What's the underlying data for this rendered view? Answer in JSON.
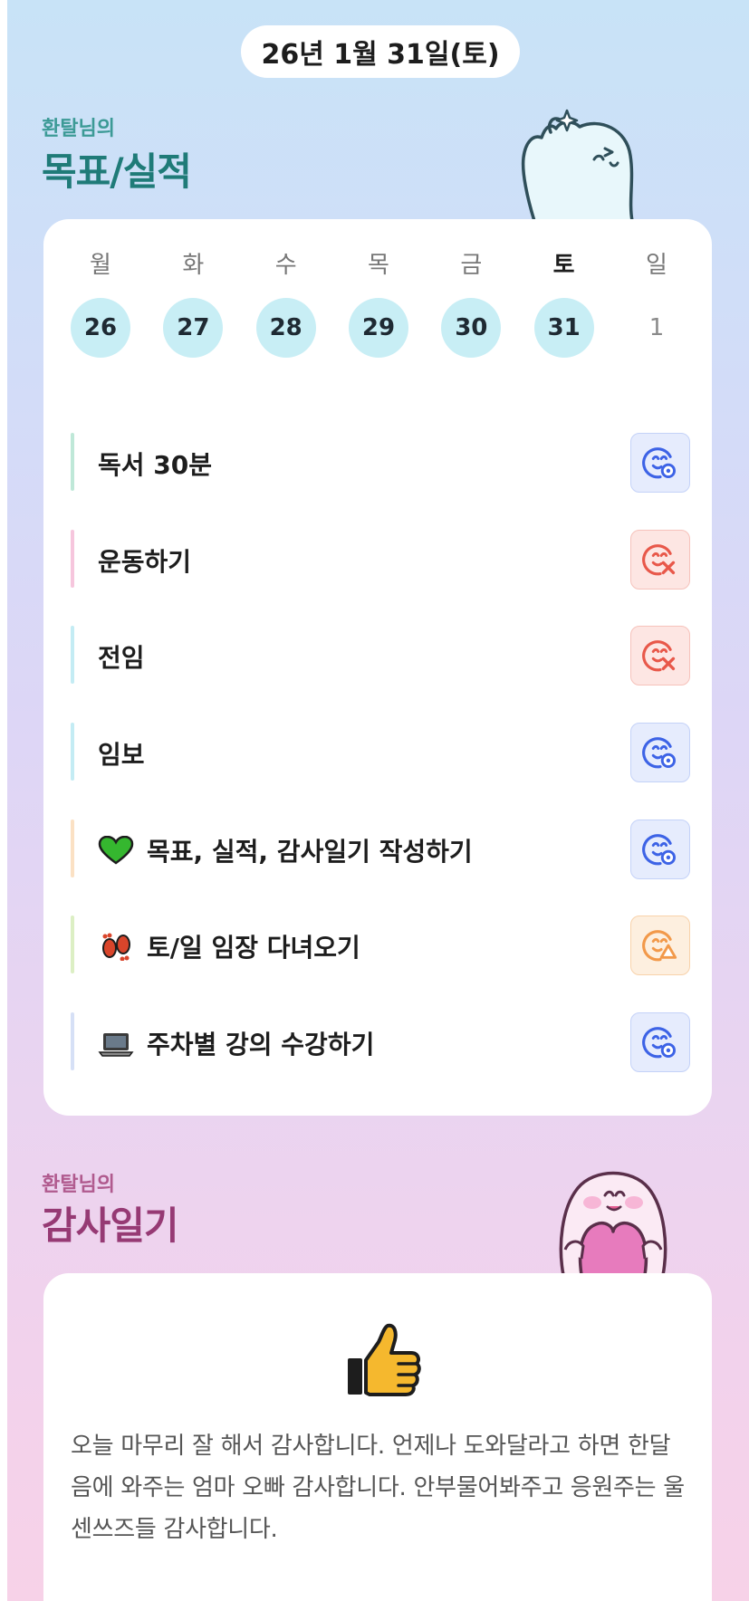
{
  "header": {
    "date": "26년 1월 31일(토)"
  },
  "goals": {
    "owner": "환탈님의",
    "title": "목표/실적",
    "week": {
      "days": [
        "월",
        "화",
        "수",
        "목",
        "금",
        "토",
        "일"
      ],
      "dates": [
        "26",
        "27",
        "28",
        "29",
        "30",
        "31",
        "1"
      ],
      "marked": [
        true,
        true,
        true,
        true,
        true,
        true,
        false
      ],
      "today_index": 5
    },
    "tasks": [
      {
        "label": "독서 30분",
        "emoji": "",
        "bar_color": "#bfe8d8",
        "status": "good",
        "status_icon": "smile-check-icon"
      },
      {
        "label": "운동하기",
        "emoji": "",
        "bar_color": "#f6c6dd",
        "status": "bad",
        "status_icon": "smile-x-icon"
      },
      {
        "label": "전임",
        "emoji": "",
        "bar_color": "#c4ecf4",
        "status": "bad",
        "status_icon": "smile-x-icon"
      },
      {
        "label": "임보",
        "emoji": "",
        "bar_color": "#c4ecf4",
        "status": "good",
        "status_icon": "smile-check-icon"
      },
      {
        "label": "목표, 실적, 감사일기 작성하기",
        "emoji": "green-heart",
        "bar_color": "#fbe1c4",
        "status": "good",
        "status_icon": "smile-check-icon"
      },
      {
        "label": "토/일 임장 다녀오기",
        "emoji": "footprints",
        "bar_color": "#dcefc4",
        "status": "warn",
        "status_icon": "smile-warning-icon"
      },
      {
        "label": "주차별 강의 수강하기",
        "emoji": "laptop",
        "bar_color": "#d6e0f6",
        "status": "good",
        "status_icon": "smile-check-icon"
      }
    ]
  },
  "diary": {
    "owner": "환탈님의",
    "title": "감사일기",
    "emoji": "thumbs-up",
    "text": "오늘 마무리 잘 해서 감사합니다. 언제나 도와달라고 하면 한달음에 와주는 엄마 오빠 감사합니다. 안부물어봐주고 응원주는 울 센쓰즈들 감사합니다."
  },
  "colors": {
    "accent_teal": "#1f7b78",
    "accent_pink": "#963a74",
    "good": "#3d63e6",
    "bad": "#e8584a",
    "warn": "#f2994a"
  }
}
